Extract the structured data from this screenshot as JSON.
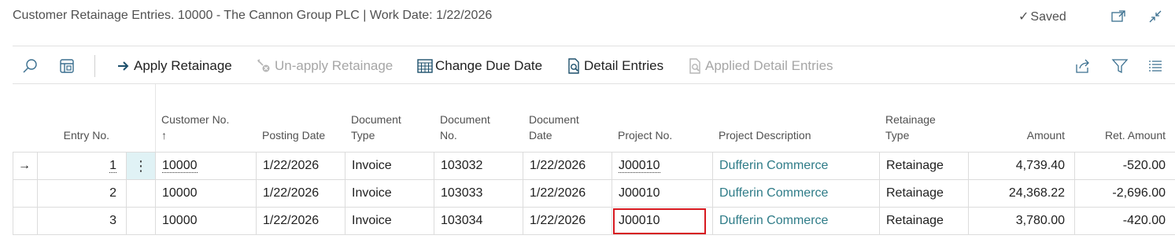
{
  "window": {
    "title": "Customer Retainage Entries. 10000 - The Cannon Group PLC | Work Date: 1/22/2026",
    "saved_label": "Saved",
    "icons": [
      "open-in-new-window-icon",
      "collapse-icon"
    ]
  },
  "toolbar": {
    "actions": [
      {
        "label": "Apply Retainage",
        "icon": "arrow-right-icon",
        "enabled": true
      },
      {
        "label": "Un-apply Retainage",
        "icon": "unapply-icon",
        "enabled": false
      },
      {
        "label": "Change Due Date",
        "icon": "calendar-icon",
        "enabled": true
      },
      {
        "label": "Detail Entries",
        "icon": "document-search-icon",
        "enabled": true
      },
      {
        "label": "Applied Detail Entries",
        "icon": "document-search-icon",
        "enabled": false
      }
    ],
    "right_icons": [
      "share-icon",
      "filter-icon",
      "list-icon"
    ],
    "left_icons": [
      "search-icon",
      "layout-icon"
    ]
  },
  "table": {
    "columns": [
      {
        "key": "entry_no",
        "label": "Entry No."
      },
      {
        "key": "customer_no",
        "label": "Customer No.",
        "sort": "↑"
      },
      {
        "key": "posting_date",
        "label": "Posting Date"
      },
      {
        "key": "document_type",
        "label": "Document Type",
        "line1": "Document",
        "line2": "Type"
      },
      {
        "key": "document_no",
        "label": "Document No.",
        "line1": "Document",
        "line2": "No."
      },
      {
        "key": "document_date",
        "label": "Document Date",
        "line1": "Document",
        "line2": "Date"
      },
      {
        "key": "project_no",
        "label": "Project No."
      },
      {
        "key": "project_description",
        "label": "Project Description"
      },
      {
        "key": "retainage_type",
        "label": "Retainage Type",
        "line1": "Retainage",
        "line2": "Type"
      },
      {
        "key": "amount",
        "label": "Amount"
      },
      {
        "key": "ret_amount",
        "label": "Ret. Amount"
      }
    ],
    "rows": [
      {
        "entry_no": "1",
        "customer_no": "10000",
        "posting_date": "1/22/2026",
        "document_type": "Invoice",
        "document_no": "103032",
        "document_date": "1/22/2026",
        "project_no": "J00010",
        "project_description": "Dufferin Commerce",
        "retainage_type": "Retainage",
        "amount": "4,739.40",
        "ret_amount": "-520.00"
      },
      {
        "entry_no": "2",
        "customer_no": "10000",
        "posting_date": "1/22/2026",
        "document_type": "Invoice",
        "document_no": "103033",
        "document_date": "1/22/2026",
        "project_no": "J00010",
        "project_description": "Dufferin Commerce",
        "retainage_type": "Retainage",
        "amount": "24,368.22",
        "ret_amount": "-2,696.00"
      },
      {
        "entry_no": "3",
        "customer_no": "10000",
        "posting_date": "1/22/2026",
        "document_type": "Invoice",
        "document_no": "103034",
        "document_date": "1/22/2026",
        "project_no": "J00010",
        "project_description": "Dufferin Commerce",
        "retainage_type": "Retainage",
        "amount": "3,780.00",
        "ret_amount": "-420.00"
      }
    ],
    "selected_row_marker": "→",
    "row_actions_glyph": "⋮"
  },
  "colors": {
    "link": "#2f7c88",
    "highlight": "#d71920",
    "selected_cell_bg": "#e0f2f5"
  }
}
